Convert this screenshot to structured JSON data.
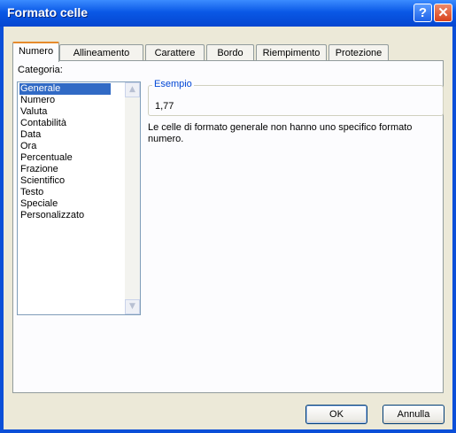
{
  "window": {
    "title": "Formato celle",
    "help_label": "?",
    "close_label": "✕"
  },
  "tabs": [
    {
      "label": "Numero"
    },
    {
      "label": "Allineamento"
    },
    {
      "label": "Carattere"
    },
    {
      "label": "Bordo"
    },
    {
      "label": "Riempimento"
    },
    {
      "label": "Protezione"
    }
  ],
  "category": {
    "label": "Categoria:",
    "items": [
      "Generale",
      "Numero",
      "Valuta",
      "Contabilità",
      "Data",
      "Ora",
      "Percentuale",
      "Frazione",
      "Scientifico",
      "Testo",
      "Speciale",
      "Personalizzato"
    ],
    "scroll_up": "▲",
    "scroll_down": "▼"
  },
  "sample": {
    "legend": "Esempio",
    "value": "1,77"
  },
  "description": "Le celle di formato generale non hanno uno specifico formato numero.",
  "buttons": {
    "ok": "OK",
    "cancel": "Annulla"
  }
}
